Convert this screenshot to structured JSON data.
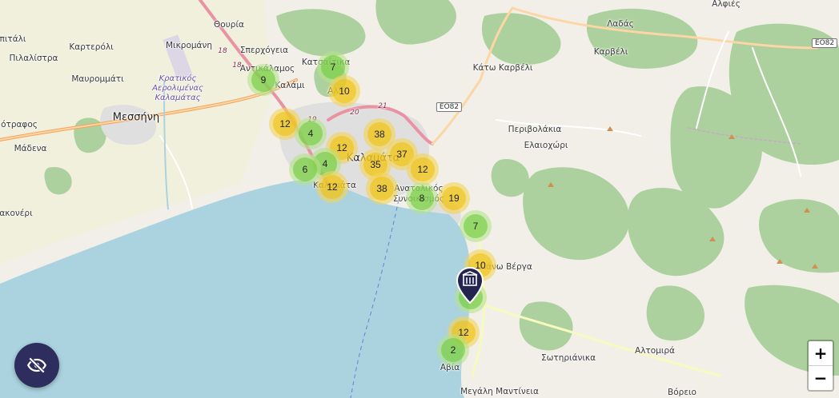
{
  "places": [
    {
      "id": "thouria",
      "text": "Θουρία"
    },
    {
      "id": "mikromani",
      "text": "Μικρομάνη"
    },
    {
      "id": "sperchogeia",
      "text": "Σπερχόγεια"
    },
    {
      "id": "katsaitika",
      "text": "Κατσαΐτικα"
    },
    {
      "id": "antikalamos",
      "text": "Αντικάλαμος"
    },
    {
      "id": "alagonia_partial",
      "text": "Αλ"
    },
    {
      "id": "kalami_partial",
      "text": "Καλάμι"
    },
    {
      "id": "pitali",
      "text": "πιτάλι"
    },
    {
      "id": "pilalistra",
      "text": "Πιλαλίστρα"
    },
    {
      "id": "karteroli",
      "text": "Καρτερόλι"
    },
    {
      "id": "mavrommati",
      "text": "Μαυρομμάτι"
    },
    {
      "id": "airport",
      "text": "Κρατικός Αερολιμένας Καλαμάτας"
    },
    {
      "id": "messini",
      "text": "Μεσσήνη"
    },
    {
      "id": "strofos",
      "text": "ότραφος"
    },
    {
      "id": "madena",
      "text": "Μάδενα"
    },
    {
      "id": "kalamata",
      "text": "Καλαμάτα"
    },
    {
      "id": "kalamata_port",
      "text": "Καλαμάτα"
    },
    {
      "id": "anatolikos",
      "text": "Ανατολικός"
    },
    {
      "id": "synoikismos",
      "text": "Συνοικισμός"
    },
    {
      "id": "pano_verga",
      "text": "Πάνω Βέργα"
    },
    {
      "id": "kato_karveli",
      "text": "Κάτω Καρβέλι"
    },
    {
      "id": "karveli",
      "text": "Καρβέλι"
    },
    {
      "id": "ladas",
      "text": "Λαδάς"
    },
    {
      "id": "alfies",
      "text": "Αλφιές"
    },
    {
      "id": "perivolakia",
      "text": "Περιβολάκια"
    },
    {
      "id": "elaiochori",
      "text": "Ελαιοχώρι"
    },
    {
      "id": "sotirianika",
      "text": "Σωτηριάνικα"
    },
    {
      "id": "altomira",
      "text": "Αλτομιρά"
    },
    {
      "id": "avia",
      "text": "Αβία"
    },
    {
      "id": "megali_mantineia",
      "text": "Μεγάλη Μαντίνεια"
    },
    {
      "id": "voreio",
      "text": "Βόρειο"
    },
    {
      "id": "kanoneri",
      "text": "ακονέρι"
    }
  ],
  "road_labels": [
    {
      "id": "r18a",
      "text": "18"
    },
    {
      "id": "r18b",
      "text": "18"
    },
    {
      "id": "r19",
      "text": "19"
    },
    {
      "id": "r20",
      "text": "20"
    },
    {
      "id": "r21",
      "text": "21"
    }
  ],
  "road_shields": [
    {
      "id": "eo82_center",
      "text": "ΕΟ82"
    },
    {
      "id": "eo82_east",
      "text": "ΕΟ82"
    }
  ],
  "clusters": [
    {
      "count": "9",
      "level": "small"
    },
    {
      "count": "7",
      "level": "small"
    },
    {
      "count": "10",
      "level": "medium"
    },
    {
      "count": "12",
      "level": "medium"
    },
    {
      "count": "4",
      "level": "small"
    },
    {
      "count": "38",
      "level": "medium"
    },
    {
      "count": "12",
      "level": "medium"
    },
    {
      "count": "37",
      "level": "medium"
    },
    {
      "count": "4",
      "level": "small"
    },
    {
      "count": "6",
      "level": "small"
    },
    {
      "count": "35",
      "level": "medium"
    },
    {
      "count": "12",
      "level": "medium"
    },
    {
      "count": "12",
      "level": "medium"
    },
    {
      "count": "38",
      "level": "medium"
    },
    {
      "count": "8",
      "level": "small"
    },
    {
      "count": "19",
      "level": "medium"
    },
    {
      "count": "7",
      "level": "small"
    },
    {
      "count": "10",
      "level": "medium"
    },
    {
      "count": "12",
      "level": "medium"
    },
    {
      "count": "2",
      "level": "small"
    }
  ],
  "marker": {
    "icon": "building-icon",
    "color": "#23254f"
  },
  "zoom": {
    "in_label": "+",
    "out_label": "−"
  },
  "toggle": {
    "icon": "eye-off-icon",
    "color": "#2e2e5e"
  },
  "colors": {
    "sea": "#aad3df",
    "land": "#f2efe9",
    "forest": "#add19e",
    "urban": "#e0dfdf",
    "cluster_small": "#6ecc39",
    "cluster_medium": "#f0c20c"
  }
}
